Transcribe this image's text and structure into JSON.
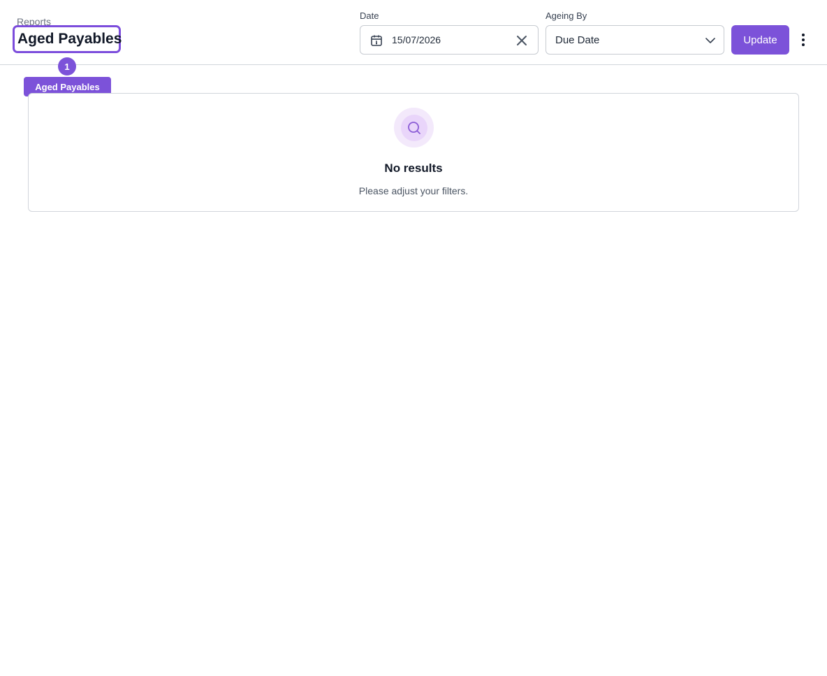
{
  "header": {
    "breadcrumb": "Reports",
    "title": "Aged Payables"
  },
  "filters": {
    "date": {
      "label": "Date",
      "value": "15/07/2026",
      "icon": "calendar-icon",
      "clear_icon": "close-icon"
    },
    "ageing_by": {
      "label": "Ageing By",
      "selected": "Due Date",
      "icon": "chevron-down-icon"
    },
    "update_label": "Update",
    "more_icon": "more-vertical-icon"
  },
  "annotation": {
    "number": "1",
    "label": "Aged Payables"
  },
  "empty_state": {
    "icon": "search-icon",
    "title": "No results",
    "subtitle": "Please adjust your filters."
  },
  "colors": {
    "accent": "#7c52d9",
    "border": "#d1d5db",
    "icon_bg_outer": "#f3e9fb",
    "icon_bg_inner": "#e9d5fa"
  }
}
